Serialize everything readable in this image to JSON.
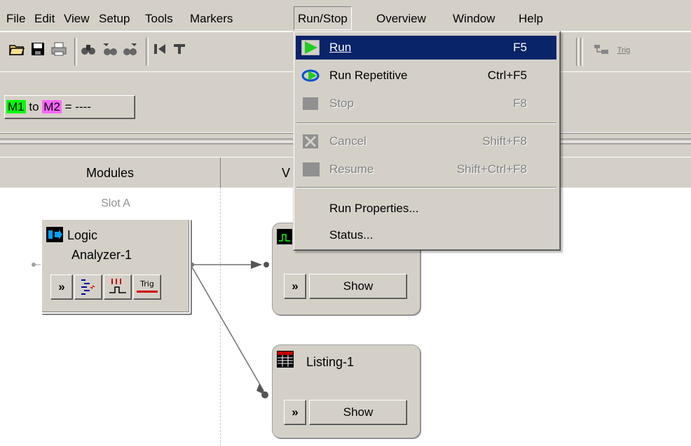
{
  "menubar": {
    "items": [
      "File",
      "Edit",
      "View",
      "Setup",
      "Tools",
      "Markers",
      "Run/Stop",
      "Overview",
      "Window",
      "Help"
    ],
    "active": "Run/Stop"
  },
  "toolbar": {
    "icons": [
      "open-folder-icon",
      "save-disk-icon",
      "print-icon",
      "find-icon",
      "find-previous-icon",
      "find-next-icon",
      "go-to-start-icon",
      "trigger-marker-icon"
    ],
    "right_icons": [
      "overview-icon",
      "trig-icon"
    ],
    "trig_label": "Trig"
  },
  "marker_bar": {
    "m1": "M1",
    "to": "to",
    "m2": "M2",
    "value": "= ----",
    "m1_color": "#00ff00",
    "m2_color": "#ff66ff"
  },
  "columns": {
    "modules": "Modules",
    "windows_partial": "V"
  },
  "canvas": {
    "slot_label": "Slot A",
    "analyzer": {
      "title_line1": "Logic",
      "title_line2": "Analyzer-1",
      "buttons": [
        "expand-icon",
        "setup-icon",
        "waveform-icon",
        "trig-icon"
      ],
      "trig_label": "Trig"
    },
    "waveform_window": {
      "button_label": "Show",
      "expand": "»"
    },
    "listing_window": {
      "title": "Listing-1",
      "button_label": "Show",
      "expand": "»"
    }
  },
  "dropdown": {
    "items": [
      {
        "label": "Run",
        "shortcut": "F5",
        "state": "selected",
        "icon": "run-play-icon"
      },
      {
        "label": "Run Repetitive",
        "shortcut": "Ctrl+F5",
        "state": "enabled",
        "icon": "run-repetitive-icon"
      },
      {
        "label": "Stop",
        "shortcut": "F8",
        "state": "disabled",
        "icon": "stop-icon"
      },
      {
        "label": "Cancel",
        "shortcut": "Shift+F8",
        "state": "disabled",
        "icon": "cancel-icon"
      },
      {
        "label": "Resume",
        "shortcut": "Shift+Ctrl+F8",
        "state": "disabled",
        "icon": "resume-icon"
      },
      {
        "label": "Run Properties...",
        "shortcut": "",
        "state": "enabled",
        "icon": ""
      },
      {
        "label": "Status...",
        "shortcut": "",
        "state": "enabled",
        "icon": ""
      }
    ],
    "highlight_color": "#0a246a"
  }
}
